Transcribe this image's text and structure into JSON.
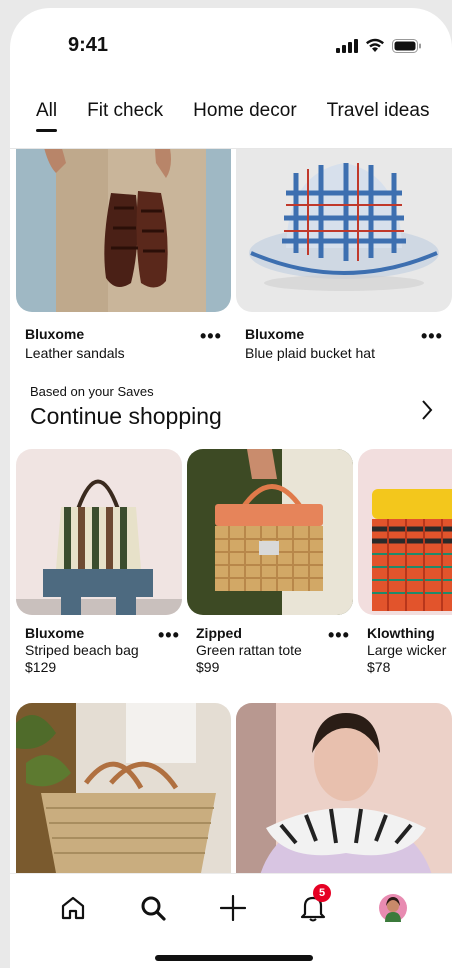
{
  "status_bar": {
    "time": "9:41"
  },
  "tabs": [
    {
      "label": "All",
      "active": true
    },
    {
      "label": "Fit check",
      "active": false
    },
    {
      "label": "Home decor",
      "active": false
    },
    {
      "label": "Travel ideas",
      "active": false
    }
  ],
  "top_pins": [
    {
      "brand": "Bluxome",
      "name": "Leather  sandals",
      "more": "•••"
    },
    {
      "brand": "Bluxome",
      "name": "Blue plaid bucket hat",
      "more": "•••"
    }
  ],
  "section": {
    "kicker": "Based on your Saves",
    "title": "Continue shopping"
  },
  "products": [
    {
      "brand": "Bluxome",
      "name": "Striped beach bag",
      "price": "$129",
      "more": "•••"
    },
    {
      "brand": "Zipped",
      "name": "Green rattan tote",
      "price": "$99",
      "more": "•••"
    },
    {
      "brand": "Klowthing",
      "name": "Large wicker",
      "price": "$78"
    }
  ],
  "bottom_nav": {
    "items": [
      "home-icon",
      "search-icon",
      "plus-icon",
      "bell-icon",
      "profile-avatar"
    ],
    "notification_count": "5"
  },
  "colors": {
    "accent": "#e60023",
    "text": "#111111"
  }
}
